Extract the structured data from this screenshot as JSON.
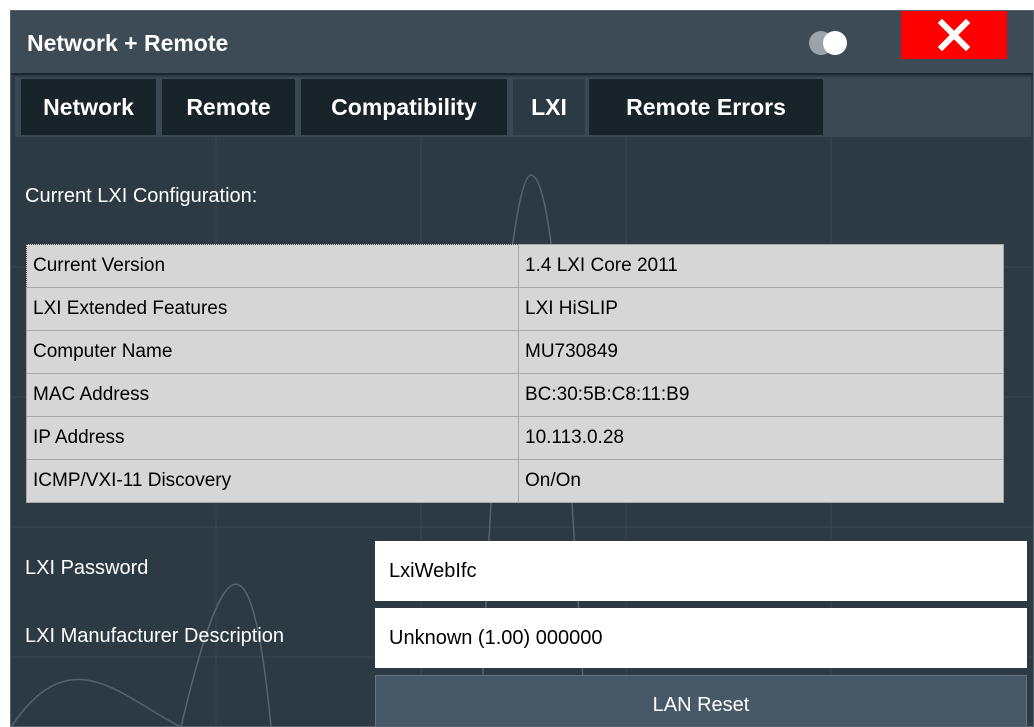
{
  "dialog": {
    "title": "Network + Remote",
    "close_symbol": "×",
    "toggle_icon": "toggle-icon"
  },
  "tabs": [
    {
      "label": "Network",
      "active": false
    },
    {
      "label": "Remote",
      "active": false
    },
    {
      "label": "Compatibility",
      "active": false
    },
    {
      "label": "LXI",
      "active": true
    },
    {
      "label": "Remote Errors",
      "active": false
    }
  ],
  "lxi": {
    "section_label": "Current LXI Configuration:",
    "config_table": [
      {
        "key": "Current Version",
        "value": "1.4 LXI Core 2011"
      },
      {
        "key": "LXI Extended Features",
        "value": "LXI HiSLIP"
      },
      {
        "key": "Computer Name",
        "value": "MU730849"
      },
      {
        "key": "MAC Address",
        "value": "BC:30:5B:C8:11:B9"
      },
      {
        "key": "IP Address",
        "value": "10.113.0.28"
      },
      {
        "key": "ICMP/VXI-11 Discovery",
        "value": " On/On"
      }
    ],
    "password_label": "LXI Password",
    "password_value": "LxiWebIfc",
    "manufacturer_label": "LXI Manufacturer Description",
    "manufacturer_value": "Unknown (1.00) 000000",
    "lan_reset_label": "LAN Reset"
  },
  "colors": {
    "dialog_bg": "#2c3a44",
    "titlebar_bg": "#3c4b55",
    "tab_bg": "#18232a",
    "close_button_bg": "#ff0000",
    "table_bg": "#d6d6d6",
    "button_bg": "#475966"
  }
}
